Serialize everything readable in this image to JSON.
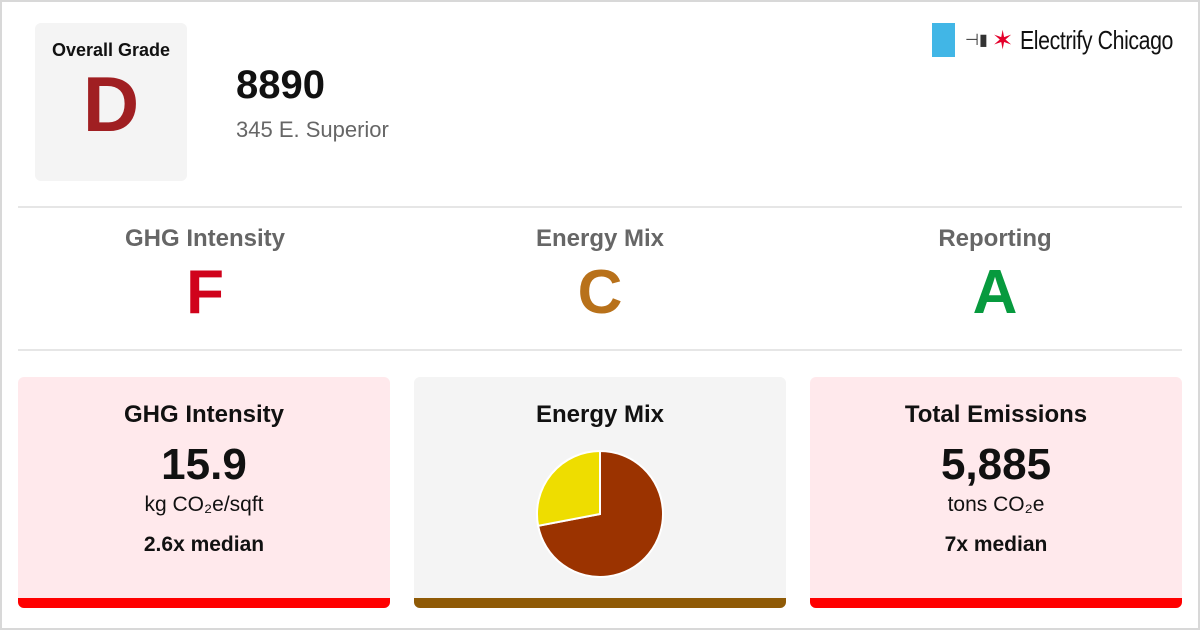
{
  "header": {
    "overall_label": "Overall Grade",
    "overall_grade": "D",
    "building_id": "8890",
    "address": "345 E. Superior",
    "logo_text": "Electrify Chicago"
  },
  "grades": [
    {
      "label": "GHG Intensity",
      "grade": "F",
      "color": "#d0021b"
    },
    {
      "label": "Energy Mix",
      "grade": "C",
      "color": "#b8711a"
    },
    {
      "label": "Reporting",
      "grade": "A",
      "color": "#079a3e"
    }
  ],
  "cards": {
    "ghg": {
      "title": "GHG Intensity",
      "value": "15.9",
      "unit": "kg CO₂e/sqft",
      "median": "2.6x median",
      "bar_color": "#ff0000"
    },
    "mix": {
      "title": "Energy Mix",
      "bar_color": "#8f5a06"
    },
    "emissions": {
      "title": "Total Emissions",
      "value": "5,885",
      "unit": "tons CO₂e",
      "median": "7x median",
      "bar_color": "#ff0000"
    }
  },
  "chart_data": {
    "type": "pie",
    "title": "Energy Mix",
    "values": [
      0.72,
      0.28
    ],
    "colors": [
      "#9b3300",
      "#eedd00"
    ]
  }
}
